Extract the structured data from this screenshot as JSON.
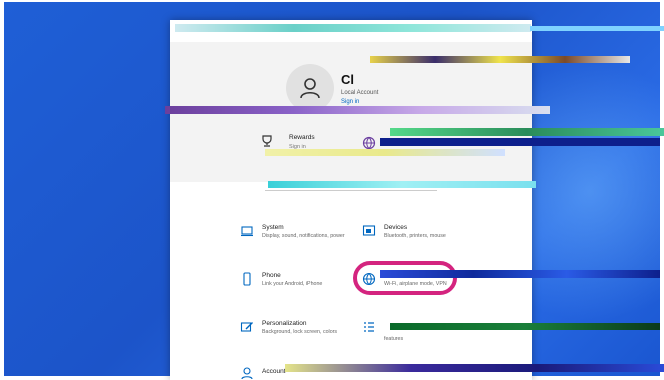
{
  "colors": {
    "desktop": "#1f5fd6",
    "accent": "#0067c0",
    "highlight": "#d4247f"
  },
  "profile": {
    "name": "Cl",
    "account_type": "Local Account",
    "sign_in": "Sign in",
    "avatar_icon": "user-icon"
  },
  "header_items": [
    {
      "label": "Rewards",
      "sub": "Sign in",
      "icon": "trophy-icon"
    },
    {
      "label": "",
      "sub": "",
      "icon": "globe-icon"
    }
  ],
  "tiles": [
    {
      "title": "System",
      "desc": "Display, sound, notifications, power",
      "icon": "laptop-icon"
    },
    {
      "title": "Devices",
      "desc": "Bluetooth, printers, mouse",
      "icon": "devices-icon"
    },
    {
      "title": "Phone",
      "desc": "Link your Android, iPhone",
      "icon": "phone-icon"
    },
    {
      "title": "",
      "desc": "Wi-Fi, airplane mode, VPN",
      "icon": "globe-icon"
    },
    {
      "title": "Personalization",
      "desc": "Background, lock screen, colors",
      "icon": "brush-icon"
    },
    {
      "title": "",
      "desc": "features",
      "icon": "apps-list-icon"
    },
    {
      "title": "Account",
      "desc": "",
      "icon": "account-icon"
    }
  ]
}
